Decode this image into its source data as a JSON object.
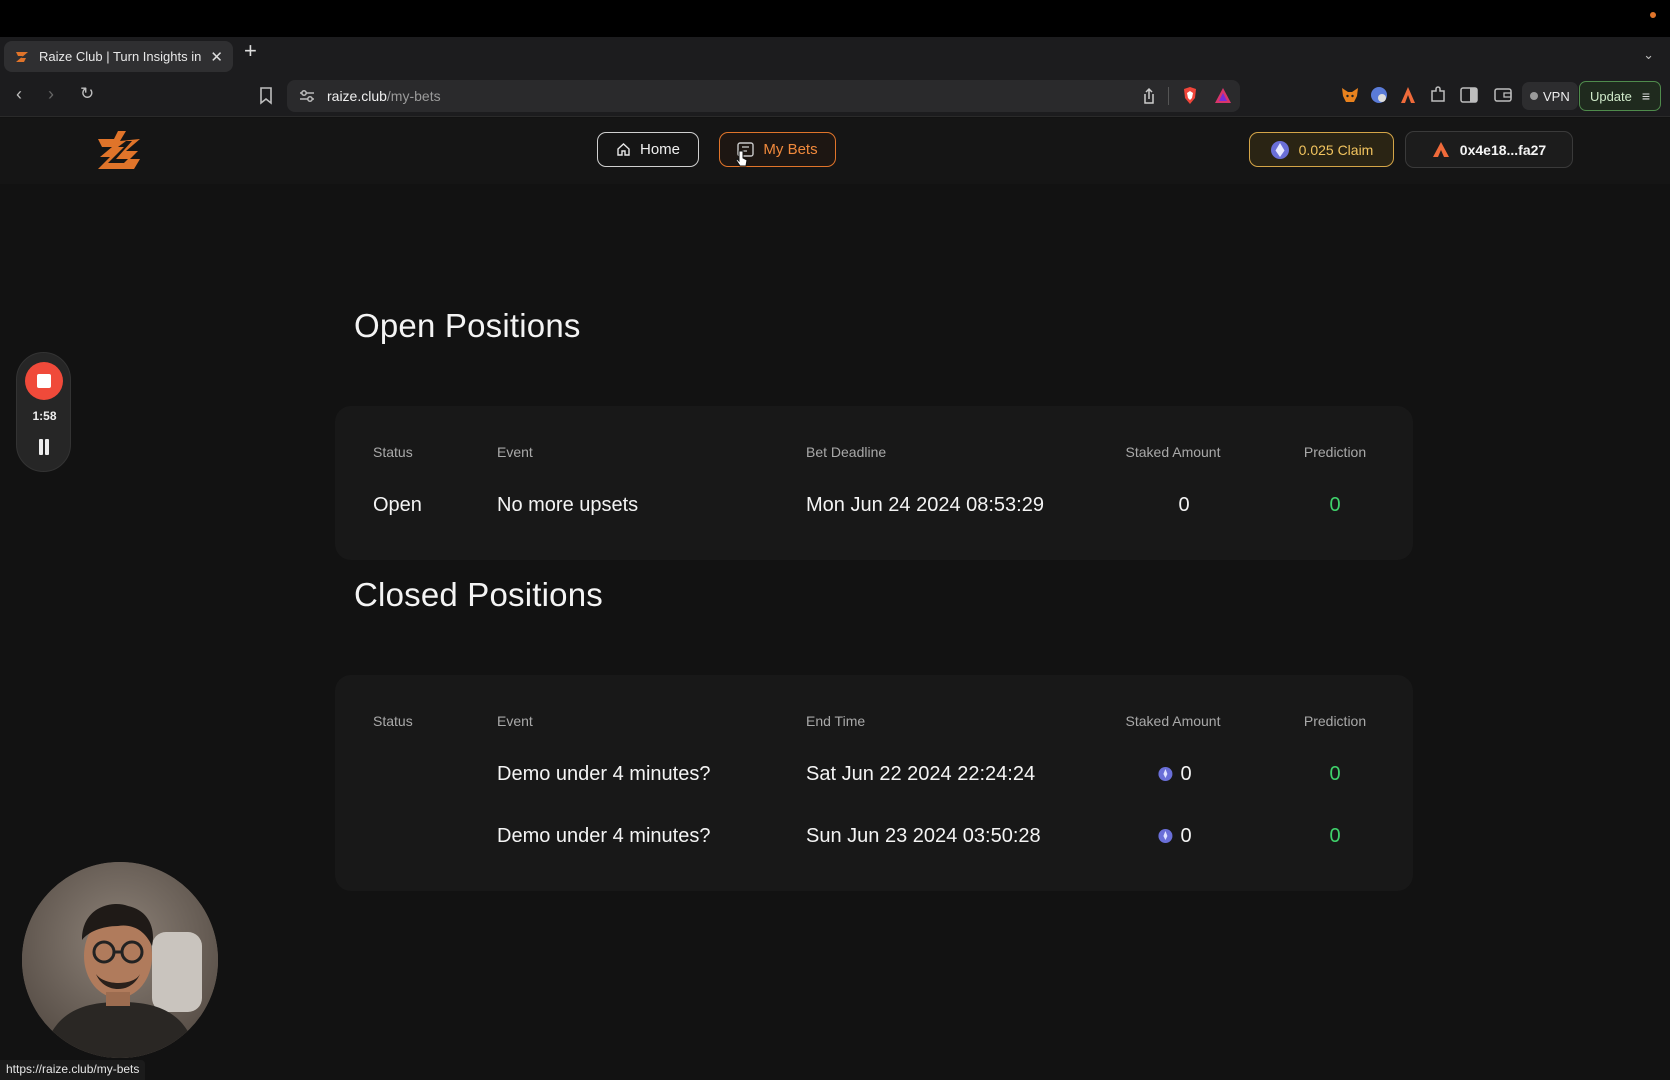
{
  "browser": {
    "tab_title": "Raize Club | Turn Insights into",
    "url_host": "raize.club",
    "url_path": "/my-bets",
    "vpn_label": "VPN",
    "update_label": "Update",
    "status_url": "https://raize.club/my-bets"
  },
  "site": {
    "nav": {
      "home": "Home",
      "my_bets": "My Bets"
    },
    "claim_label": "0.025 Claim",
    "wallet_label": "0x4e18...fa27"
  },
  "open_positions": {
    "title": "Open Positions",
    "headers": [
      "Status",
      "Event",
      "Bet Deadline",
      "Staked Amount",
      "Prediction"
    ],
    "rows": [
      {
        "status": "Open",
        "event": "No more upsets",
        "time": "Mon Jun 24 2024 08:53:29",
        "staked": "0",
        "prediction": "0"
      }
    ]
  },
  "closed_positions": {
    "title": "Closed Positions",
    "headers": [
      "Status",
      "Event",
      "End Time",
      "Staked Amount",
      "Prediction"
    ],
    "rows": [
      {
        "status": "",
        "event": "Demo under 4 minutes?",
        "time": "Sat Jun 22 2024 22:24:24",
        "staked": "0",
        "prediction": "0"
      },
      {
        "status": "",
        "event": "Demo under 4 minutes?",
        "time": "Sun Jun 23 2024 03:50:28",
        "staked": "0",
        "prediction": "0"
      }
    ]
  },
  "recorder": {
    "time": "1:58"
  },
  "colors": {
    "accent": "#e0742a",
    "gold": "#d4a548",
    "green": "#3fd26b"
  }
}
